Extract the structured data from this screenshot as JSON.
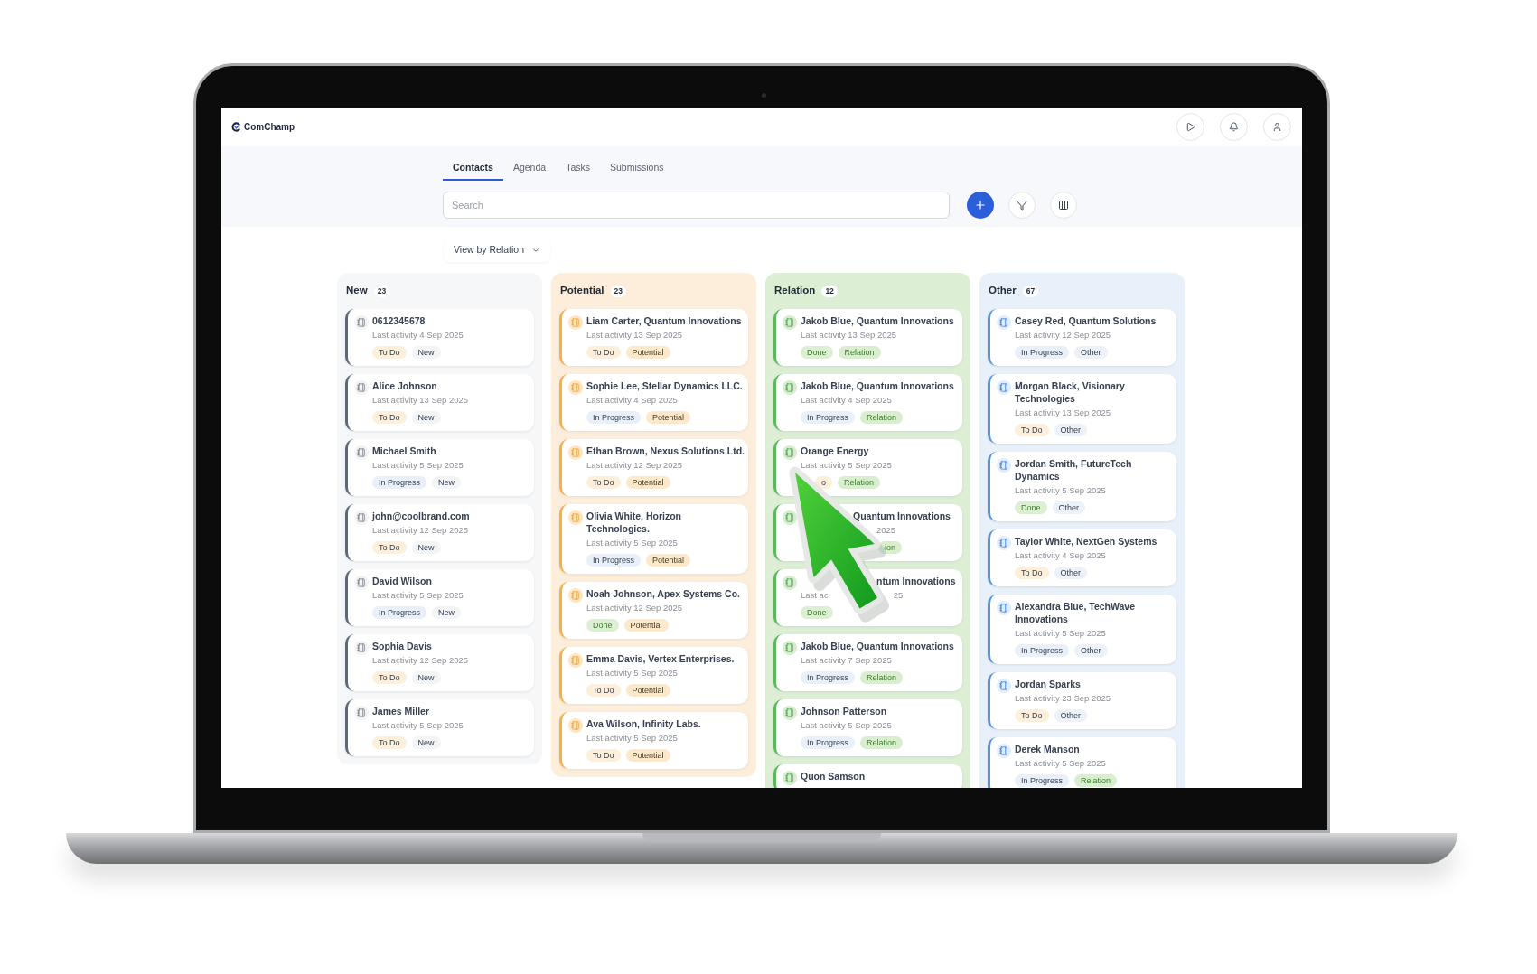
{
  "app": {
    "brand": "ComChamp"
  },
  "tabs": [
    {
      "label": "Contacts",
      "selected": true
    },
    {
      "label": "Agenda",
      "selected": false
    },
    {
      "label": "Tasks",
      "selected": false
    },
    {
      "label": "Submissions",
      "selected": false
    }
  ],
  "search": {
    "placeholder": "Search"
  },
  "view_selector": {
    "label": "View by Relation"
  },
  "columns": [
    {
      "title": "New",
      "count": "23",
      "kind": "new",
      "cards": [
        {
          "name": "0612345678",
          "activity": "Last activity 4 Sep 2025",
          "tags": [
            {
              "label": "To Do",
              "kind": "todo"
            },
            {
              "label": "New",
              "kind": "new"
            }
          ]
        },
        {
          "name": "Alice Johnson",
          "activity": "Last activity 13 Sep 2025",
          "tags": [
            {
              "label": "To Do",
              "kind": "todo"
            },
            {
              "label": "New",
              "kind": "new"
            }
          ]
        },
        {
          "name": "Michael Smith",
          "activity": "Last activity 5 Sep 2025",
          "tags": [
            {
              "label": "In Progress",
              "kind": "progress"
            },
            {
              "label": "New",
              "kind": "new"
            }
          ]
        },
        {
          "name": "john@coolbrand.com",
          "activity": "Last activity 12 Sep 2025",
          "tags": [
            {
              "label": "To Do",
              "kind": "todo"
            },
            {
              "label": "New",
              "kind": "new"
            }
          ]
        },
        {
          "name": "David Wilson",
          "activity": "Last activity 5 Sep 2025",
          "tags": [
            {
              "label": "In Progress",
              "kind": "progress"
            },
            {
              "label": "New",
              "kind": "new"
            }
          ]
        },
        {
          "name": "Sophia Davis",
          "activity": "Last activity 12 Sep 2025",
          "tags": [
            {
              "label": "To Do",
              "kind": "todo"
            },
            {
              "label": "New",
              "kind": "new"
            }
          ]
        },
        {
          "name": "James Miller",
          "activity": "Last activity 5 Sep 2025",
          "tags": [
            {
              "label": "To Do",
              "kind": "todo"
            },
            {
              "label": "New",
              "kind": "new"
            }
          ]
        }
      ]
    },
    {
      "title": "Potential",
      "count": "23",
      "kind": "potential",
      "cards": [
        {
          "name": "Liam Carter, Quantum Innovations",
          "activity": "Last activity 13 Sep 2025",
          "tags": [
            {
              "label": "To Do",
              "kind": "todo"
            },
            {
              "label": "Potential",
              "kind": "potential"
            }
          ]
        },
        {
          "name": "Sophie Lee, Stellar Dynamics LLC.",
          "activity": "Last activity 4 Sep 2025",
          "tags": [
            {
              "label": "In Progress",
              "kind": "progress"
            },
            {
              "label": "Potential",
              "kind": "potential"
            }
          ]
        },
        {
          "name": "Ethan Brown, Nexus Solutions Ltd.",
          "activity": "Last activity 12 Sep 2025",
          "tags": [
            {
              "label": "To Do",
              "kind": "todo"
            },
            {
              "label": "Potential",
              "kind": "potential"
            }
          ]
        },
        {
          "name": "Olivia White, Horizon Technologies.",
          "activity": "Last activity 5 Sep 2025",
          "tags": [
            {
              "label": "In Progress",
              "kind": "progress"
            },
            {
              "label": "Potential",
              "kind": "potential"
            }
          ]
        },
        {
          "name": "Noah Johnson, Apex Systems Co.",
          "activity": "Last activity 12 Sep 2025",
          "tags": [
            {
              "label": "Done",
              "kind": "done"
            },
            {
              "label": "Potential",
              "kind": "potential"
            }
          ]
        },
        {
          "name": "Emma Davis, Vertex Enterprises.",
          "activity": "Last activity 5 Sep 2025",
          "tags": [
            {
              "label": "To Do",
              "kind": "todo"
            },
            {
              "label": "Potential",
              "kind": "potential"
            }
          ]
        },
        {
          "name": "Ava Wilson, Infinity Labs.",
          "activity": "Last activity 5 Sep 2025",
          "tags": [
            {
              "label": "To Do",
              "kind": "todo"
            },
            {
              "label": "Potential",
              "kind": "potential"
            }
          ]
        }
      ]
    },
    {
      "title": "Relation",
      "count": "12",
      "kind": "relation",
      "cards": [
        {
          "name": "Jakob Blue, Quantum Innovations",
          "activity": "Last activity 13 Sep 2025",
          "tags": [
            {
              "label": "Done",
              "kind": "done"
            },
            {
              "label": "Relation",
              "kind": "relation"
            }
          ]
        },
        {
          "name": "Jakob Blue, Quantum Innovations",
          "activity": "Last activity 4 Sep 2025",
          "tags": [
            {
              "label": "In Progress",
              "kind": "progress"
            },
            {
              "label": "Relation",
              "kind": "relation"
            }
          ]
        },
        {
          "name": "Orange Energy",
          "activity": "Last activity 5 Sep 2025",
          "covered": true,
          "tags": [
            {
              "label": "o",
              "kind": "todo"
            },
            {
              "label": "Relation",
              "kind": "relation"
            }
          ]
        },
        {
          "name": "Quantum Innovations",
          "activity": "2025",
          "covered": true,
          "tags": [
            {
              "label": "ion",
              "kind": "relation"
            }
          ]
        },
        {
          "name": "ntum Innovations",
          "activity": "Last ac",
          "activity_tail": "25",
          "covered": true,
          "tags": [
            {
              "label": "Done",
              "kind": "done"
            }
          ]
        },
        {
          "name": "Jakob Blue, Quantum Innovations",
          "activity": "Last activity 7 Sep 2025",
          "tags": [
            {
              "label": "In Progress",
              "kind": "progress"
            },
            {
              "label": "Relation",
              "kind": "relation"
            }
          ]
        },
        {
          "name": "Johnson Patterson",
          "activity": "Last activity 5 Sep 2025",
          "tags": [
            {
              "label": "In Progress",
              "kind": "progress"
            },
            {
              "label": "Relation",
              "kind": "relation"
            }
          ]
        },
        {
          "name": "Quon Samson"
        }
      ]
    },
    {
      "title": "Other",
      "count": "67",
      "kind": "other",
      "cards": [
        {
          "name": "Casey Red, Quantum Solutions",
          "activity": "Last activity 12 Sep 2025",
          "tags": [
            {
              "label": "In Progress",
              "kind": "progress"
            },
            {
              "label": "Other",
              "kind": "other"
            }
          ]
        },
        {
          "name": "Morgan Black, Visionary Technologies",
          "activity": "Last activity 13 Sep 2025",
          "tags": [
            {
              "label": "To Do",
              "kind": "todo"
            },
            {
              "label": "Other",
              "kind": "other"
            }
          ]
        },
        {
          "name": "Jordan Smith, FutureTech Dynamics",
          "activity": "Last activity 5 Sep 2025",
          "tags": [
            {
              "label": "Done",
              "kind": "done"
            },
            {
              "label": "Other",
              "kind": "other"
            }
          ]
        },
        {
          "name": "Taylor White, NextGen Systems",
          "activity": "Last activity 4 Sep 2025",
          "tags": [
            {
              "label": "To Do",
              "kind": "todo"
            },
            {
              "label": "Other",
              "kind": "other"
            }
          ]
        },
        {
          "name": "Alexandra Blue, TechWave Innovations",
          "activity": "Last activity 5 Sep 2025",
          "tags": [
            {
              "label": "In Progress",
              "kind": "progress"
            },
            {
              "label": "Other",
              "kind": "other"
            }
          ]
        },
        {
          "name": "Jordan Sparks",
          "activity": "Last activity 23 Sep 2025",
          "tags": [
            {
              "label": "To Do",
              "kind": "todo"
            },
            {
              "label": "Other",
              "kind": "other"
            }
          ]
        },
        {
          "name": "Derek Manson",
          "activity": "Last activity 5 Sep 2025",
          "tags": [
            {
              "label": "In Progress",
              "kind": "progress"
            },
            {
              "label": "Relation",
              "kind": "relation"
            }
          ]
        }
      ]
    }
  ]
}
